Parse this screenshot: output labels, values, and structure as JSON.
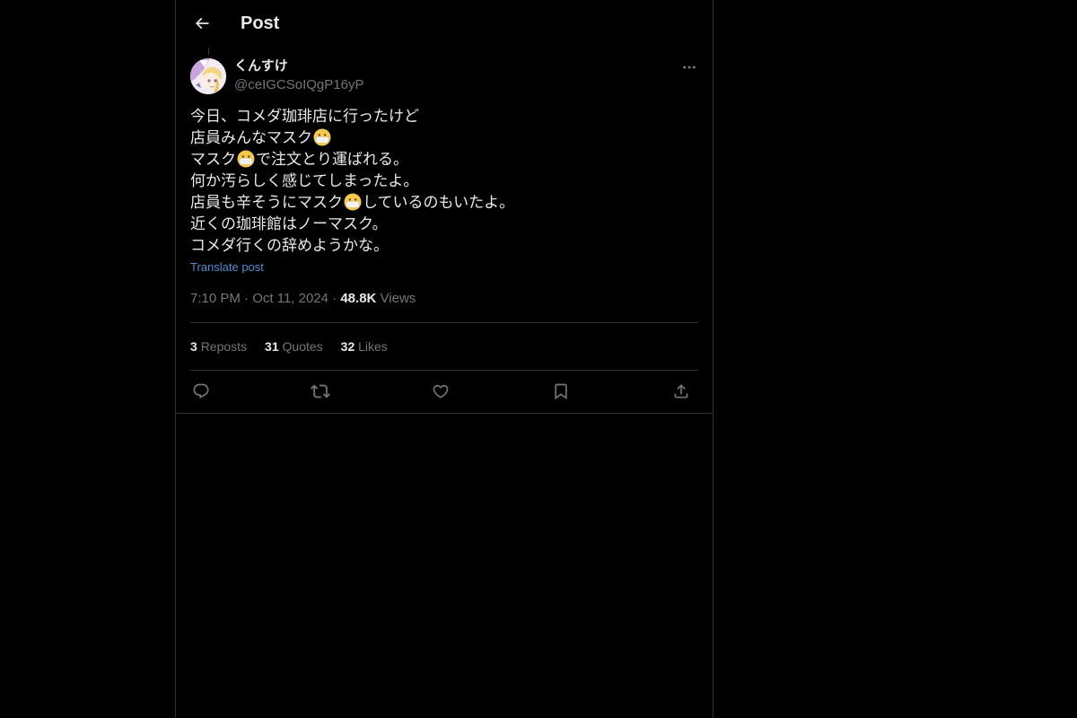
{
  "header": {
    "title": "Post"
  },
  "author": {
    "display_name": "くんすけ",
    "handle": "@ceIGCSoIQgP16yP"
  },
  "post": {
    "lines": [
      {
        "before": "今日、コメダ珈琲店に行ったけど",
        "emoji": "",
        "after": ""
      },
      {
        "before": "店員みんなマスク",
        "emoji": "mask-face",
        "after": ""
      },
      {
        "before": "マスク",
        "emoji": "mask-face",
        "after": "で注文とり運ばれる。"
      },
      {
        "before": "何か汚らしく感じてしまったよ。",
        "emoji": "",
        "after": ""
      },
      {
        "before": "店員も辛そうにマスク",
        "emoji": "mask-face",
        "after": "しているのもいたよ。"
      },
      {
        "before": "近くの珈琲館はノーマスク。",
        "emoji": "",
        "after": ""
      },
      {
        "before": "コメダ行くの辞めようかな。",
        "emoji": "",
        "after": ""
      }
    ],
    "translate_label": "Translate post"
  },
  "meta": {
    "time": "7:10 PM",
    "separator": "·",
    "date": "Oct 11, 2024",
    "views_count": "48.8K",
    "views_label": "Views"
  },
  "stats": {
    "reposts_count": "3",
    "reposts_label": "Reposts",
    "quotes_count": "31",
    "quotes_label": "Quotes",
    "likes_count": "32",
    "likes_label": "Likes"
  },
  "icons": {
    "back": "arrow-left-icon",
    "more": "more-horizontal-icon",
    "reply": "reply-icon",
    "repost": "repost-icon",
    "like": "heart-icon",
    "bookmark": "bookmark-icon",
    "share": "share-icon",
    "emoji": "face-with-medical-mask"
  },
  "colors": {
    "background": "#000000",
    "text_primary": "#e7e9ea",
    "text_secondary": "#71767b",
    "border": "#2f3336",
    "link": "#4f8fd4"
  }
}
